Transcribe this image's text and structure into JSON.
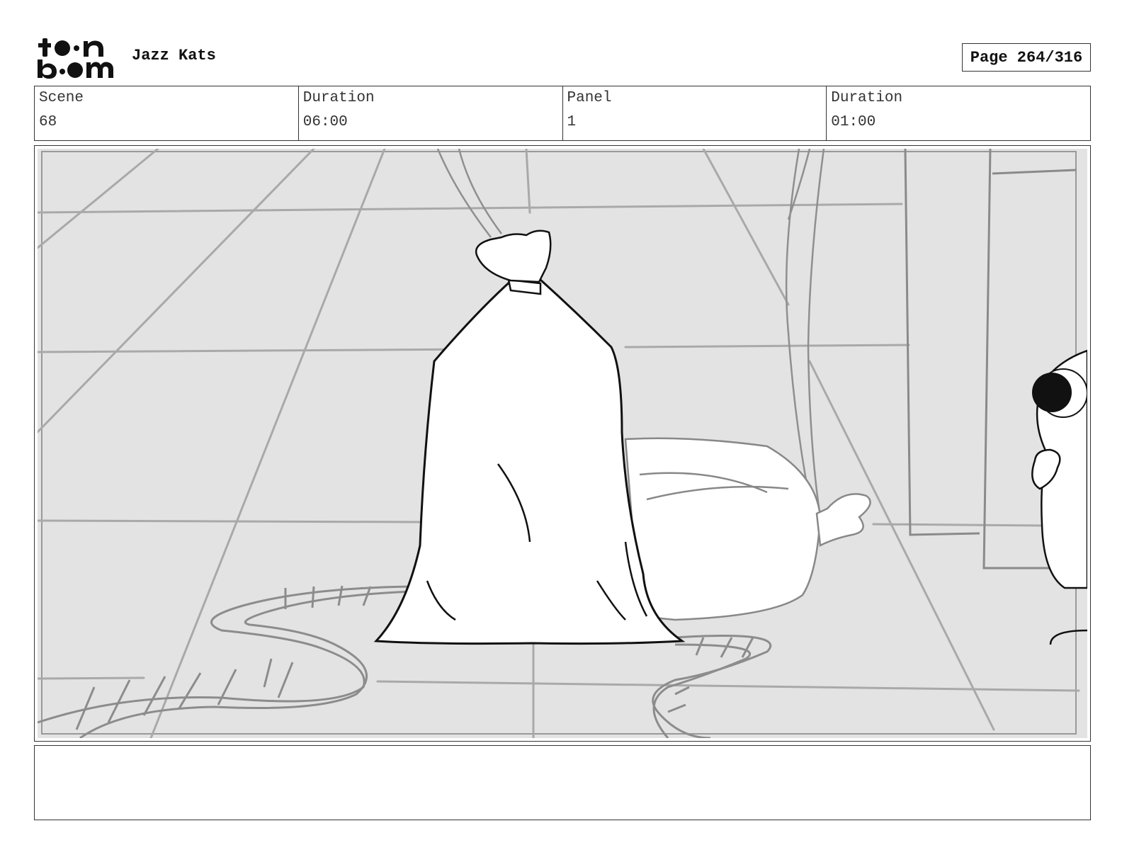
{
  "header": {
    "logo_alt": "toon boom",
    "project_title": "Jazz Kats",
    "page_indicator": "Page 264/316"
  },
  "info": {
    "scene_label": "Scene",
    "scene_value": "68",
    "scene_duration_label": "Duration",
    "scene_duration_value": "06:00",
    "panel_label": "Panel",
    "panel_value": "1",
    "panel_duration_label": "Duration",
    "panel_duration_value": "01:00"
  },
  "panel": {
    "description": ""
  },
  "notes": {
    "text": ""
  }
}
